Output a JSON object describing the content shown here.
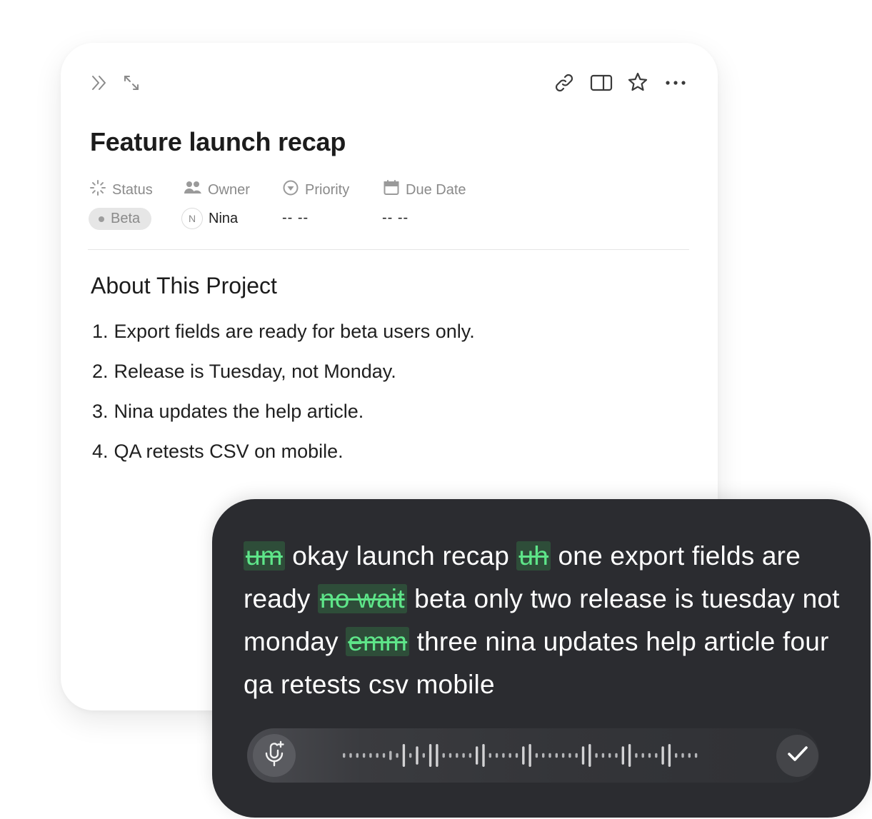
{
  "page": {
    "title": "Feature launch recap",
    "toolbar": {
      "left_icons": [
        "double-chevron-right-icon",
        "expand-icon"
      ],
      "right_icons": [
        "link-icon",
        "side-panel-icon",
        "star-icon",
        "more-icon"
      ]
    },
    "properties": {
      "status": {
        "label": "Status",
        "value": "Beta",
        "icon": "status-icon"
      },
      "owner": {
        "label": "Owner",
        "value": "Nina",
        "avatar_initial": "N",
        "icon": "people-icon"
      },
      "priority": {
        "label": "Priority",
        "value": "-- --",
        "icon": "priority-icon"
      },
      "due_date": {
        "label": "Due Date",
        "value": "-- --",
        "icon": "calendar-icon"
      }
    },
    "section_title": "About This Project",
    "list": [
      {
        "num": "1.",
        "text": "Export fields are ready for beta users only."
      },
      {
        "num": "2.",
        "text": "Release is Tuesday, not Monday."
      },
      {
        "num": "3.",
        "text": "Nina updates the help article."
      },
      {
        "num": "4.",
        "text": "QA retests CSV on mobile."
      }
    ]
  },
  "dictation": {
    "segments": [
      {
        "text": "um",
        "filler": true
      },
      {
        "text": " okay launch recap ",
        "filler": false
      },
      {
        "text": "uh",
        "filler": true
      },
      {
        "text": " one export fields are ready ",
        "filler": false
      },
      {
        "text": "no wait",
        "filler": true
      },
      {
        "text": " beta only two release is tuesday not monday ",
        "filler": false
      },
      {
        "text": "emm",
        "filler": true
      },
      {
        "text": " three nina updates help article four qa retests csv mobile",
        "filler": false
      }
    ],
    "mic_icon": "mic-sparkle-icon",
    "confirm_icon": "checkmark-icon",
    "waveform_levels": [
      0.2,
      0.2,
      0.2,
      0.2,
      0.2,
      0.2,
      0.2,
      0.4,
      0.2,
      1,
      0.2,
      0.8,
      0.2,
      1,
      1,
      0.2,
      0.2,
      0.2,
      0.2,
      0.2,
      0.8,
      1,
      0.2,
      0.2,
      0.2,
      0.2,
      0.2,
      0.8,
      1,
      0.2,
      0.2,
      0.2,
      0.2,
      0.2,
      0.2,
      0.2,
      0.8,
      1,
      0.2,
      0.2,
      0.2,
      0.2,
      0.8,
      1,
      0.2,
      0.2,
      0.2,
      0.2,
      0.8,
      1,
      0.2,
      0.2,
      0.2,
      0.2
    ]
  },
  "colors": {
    "filler_highlight_bg": "#2e4d39",
    "filler_text": "#5ee589",
    "dictation_bg": "#2b2c30"
  }
}
